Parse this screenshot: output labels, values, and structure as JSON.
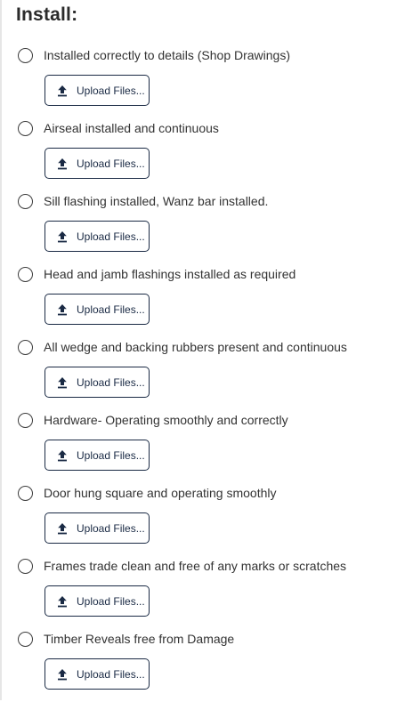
{
  "section": {
    "title": "Install:"
  },
  "checklist": [
    {
      "label": "Installed correctly to details (Shop Drawings)",
      "upload_label": "Upload Files..."
    },
    {
      "label": "Airseal installed and continuous",
      "upload_label": "Upload Files..."
    },
    {
      "label": "Sill flashing installed, Wanz bar installed.",
      "upload_label": "Upload Files..."
    },
    {
      "label": "Head and jamb flashings installed as required",
      "upload_label": "Upload Files..."
    },
    {
      "label": "All wedge and backing rubbers present and continuous",
      "upload_label": "Upload Files..."
    },
    {
      "label": "Hardware- Operating smoothly and correctly",
      "upload_label": "Upload Files..."
    },
    {
      "label": "Door hung square and operating smoothly",
      "upload_label": "Upload Files..."
    },
    {
      "label": "Frames trade clean and free of any marks or scratches",
      "upload_label": "Upload Files..."
    },
    {
      "label": "Timber Reveals free from Damage",
      "upload_label": "Upload Files..."
    }
  ],
  "icons": {
    "radio": "radio-unchecked-icon",
    "upload": "upload-arrow-icon"
  },
  "colors": {
    "text": "#333333",
    "button_border": "#1a2a44",
    "button_text": "#1a2a44"
  }
}
